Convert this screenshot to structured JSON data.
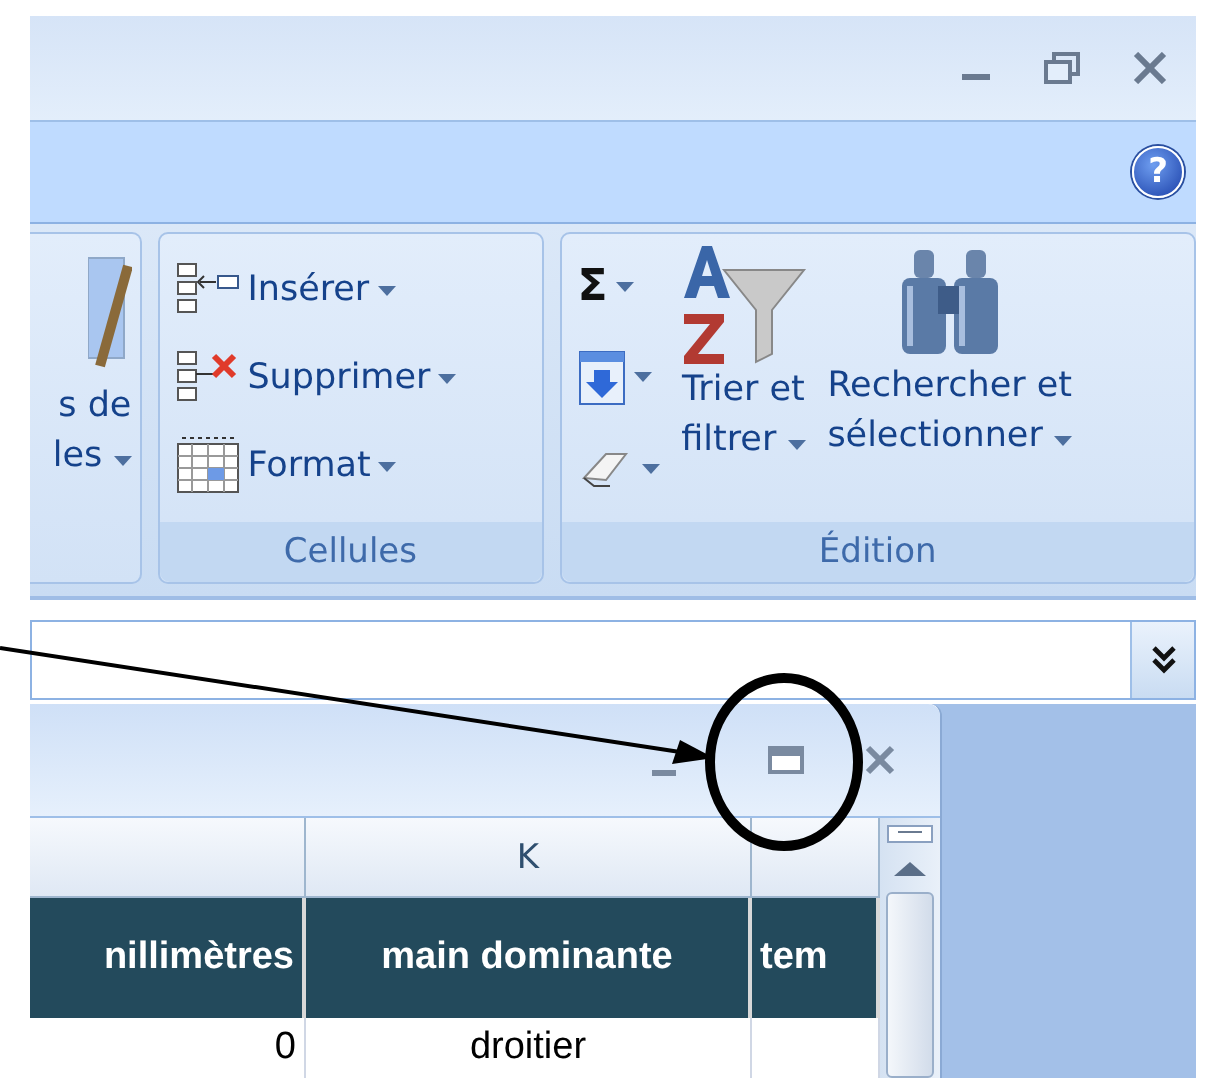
{
  "help": "?",
  "ribbon": {
    "styles_button": {
      "lines": [
        "s de",
        "les"
      ]
    },
    "groups": [
      {
        "kind": "cells",
        "label": "Cellules",
        "items": [
          {
            "label": "Insérer"
          },
          {
            "label": "Supprimer"
          },
          {
            "label": "Format"
          }
        ]
      },
      {
        "kind": "editing",
        "label": "Édition",
        "sum": "Σ",
        "big": [
          {
            "lines": [
              "Trier et",
              "filtrer"
            ]
          },
          {
            "lines": [
              "Rechercher et",
              "sélectionner"
            ]
          }
        ]
      }
    ]
  },
  "sheet": {
    "columns": [
      {
        "heading": "nillimètres",
        "cells": [
          "0"
        ]
      },
      {
        "letter": "K",
        "heading": "main dominante",
        "cells": [
          "droitier"
        ]
      },
      {
        "heading": "tem"
      }
    ]
  }
}
